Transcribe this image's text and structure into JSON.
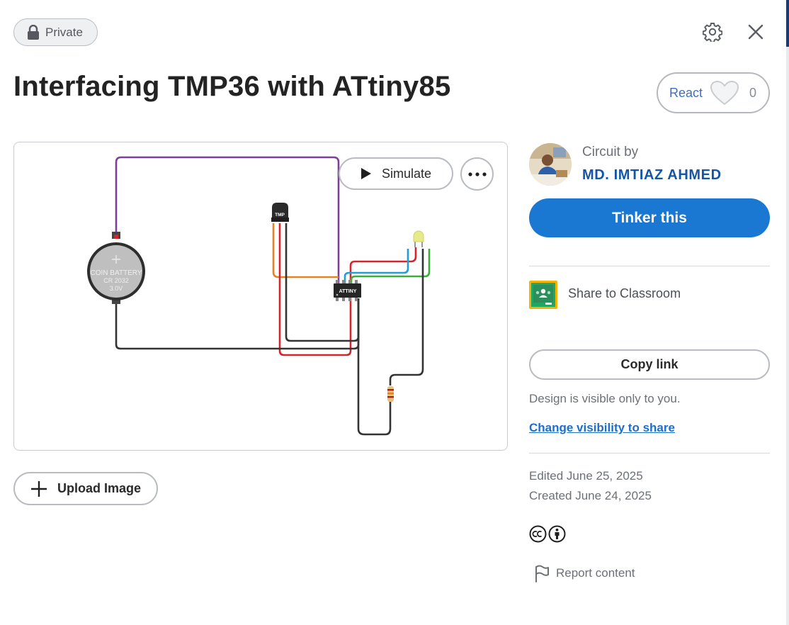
{
  "header": {
    "visibility_badge": "Private",
    "title": "Interfacing TMP36 with ATtiny85"
  },
  "react": {
    "label": "React",
    "count": "0"
  },
  "canvas": {
    "simulate_label": "Simulate",
    "components": {
      "battery_line1": "COIN BATTERY",
      "battery_line2": "CR 2032",
      "battery_line3": "3.0V",
      "sensor_label": "TMP",
      "chip_label": "ATTINY"
    },
    "upload_label": "Upload Image"
  },
  "author": {
    "label": "Circuit by",
    "name": "MD. IMTIAZ AHMED"
  },
  "actions": {
    "tinker_label": "Tinker this",
    "classroom_label": "Share to Classroom",
    "copy_link_label": "Copy link"
  },
  "visibility": {
    "note": "Design is visible only to you.",
    "change_link": "Change visibility to share"
  },
  "dates": {
    "edited": "Edited June 25, 2025",
    "created": "Created June 24, 2025"
  },
  "report_label": "Report content",
  "colors": {
    "accent": "#1a77d2",
    "author_name": "#1356a8",
    "wire_purple": "#7d3f98",
    "wire_orange": "#e8821e",
    "wire_red": "#d8232a",
    "wire_blue": "#1f9ed8",
    "wire_green": "#3aae3a",
    "wire_black": "#333333"
  },
  "icons": {
    "badge": "lock-icon",
    "settings": "gear-icon",
    "close": "close-icon",
    "react": "heart-icon",
    "simulate": "play-icon",
    "more": "more-dots-icon",
    "upload": "plus-icon",
    "classroom": "google-classroom-icon",
    "license": "creative-commons-by-icon",
    "report": "flag-icon"
  }
}
